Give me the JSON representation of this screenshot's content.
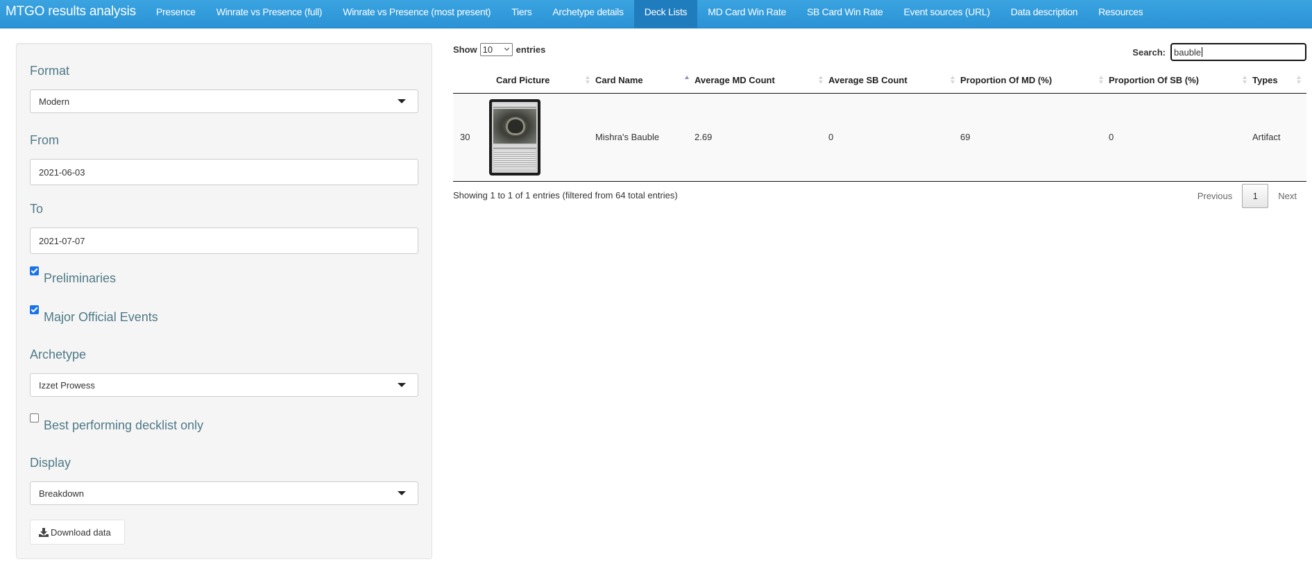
{
  "navbar": {
    "brand": "MTGO results analysis",
    "items": [
      {
        "label": "Presence",
        "active": false
      },
      {
        "label": "Winrate vs Presence (full)",
        "active": false
      },
      {
        "label": "Winrate vs Presence (most present)",
        "active": false
      },
      {
        "label": "Tiers",
        "active": false
      },
      {
        "label": "Archetype details",
        "active": false
      },
      {
        "label": "Deck Lists",
        "active": true
      },
      {
        "label": "MD Card Win Rate",
        "active": false
      },
      {
        "label": "SB Card Win Rate",
        "active": false
      },
      {
        "label": "Event sources (URL)",
        "active": false
      },
      {
        "label": "Data description",
        "active": false
      },
      {
        "label": "Resources",
        "active": false
      }
    ]
  },
  "sidebar": {
    "format": {
      "label": "Format",
      "value": "Modern"
    },
    "from": {
      "label": "From",
      "value": "2021-06-03"
    },
    "to": {
      "label": "To",
      "value": "2021-07-07"
    },
    "preliminaries": {
      "label": "Preliminaries",
      "checked": true
    },
    "major_events": {
      "label": "Major Official Events",
      "checked": true
    },
    "archetype": {
      "label": "Archetype",
      "value": "Izzet Prowess"
    },
    "best_only": {
      "label": "Best performing decklist only",
      "checked": false
    },
    "display": {
      "label": "Display",
      "value": "Breakdown"
    },
    "download_label": "Download data",
    "download_icon": "download-icon"
  },
  "table_controls": {
    "show_label": "Show",
    "entries_label": "entries",
    "page_length": "10",
    "search_label": "Search:",
    "search_value": "bauble"
  },
  "table": {
    "columns": [
      {
        "label": "",
        "sort": "none"
      },
      {
        "label": "Card Picture",
        "sort": "both"
      },
      {
        "label": "Card Name",
        "sort": "asc"
      },
      {
        "label": "Average MD Count",
        "sort": "both"
      },
      {
        "label": "Average SB Count",
        "sort": "both"
      },
      {
        "label": "Proportion Of MD (%)",
        "sort": "both"
      },
      {
        "label": "Proportion Of SB (%)",
        "sort": "both"
      },
      {
        "label": "Types",
        "sort": "both"
      }
    ],
    "rows": [
      {
        "index": "30",
        "card_picture": "Mishra's Bauble card image",
        "card_name": "Mishra's Bauble",
        "avg_md": "2.69",
        "avg_sb": "0",
        "prop_md": "69",
        "prop_sb": "0",
        "types": "Artifact"
      }
    ]
  },
  "footer": {
    "info": "Showing 1 to 1 of 1 entries (filtered from 64 total entries)",
    "previous": "Previous",
    "current_page": "1",
    "next": "Next"
  }
}
